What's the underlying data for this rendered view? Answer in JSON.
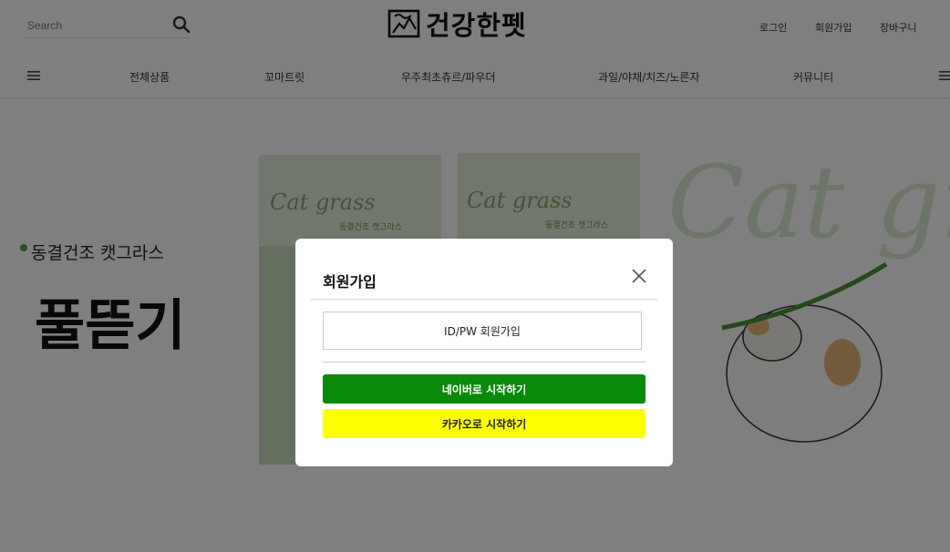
{
  "header": {
    "search_placeholder": "Search",
    "logo_text": "건강한펫",
    "links": [
      "로그인",
      "회원가입",
      "장바구니"
    ]
  },
  "nav": {
    "items": [
      "전체상품",
      "꼬마트릿",
      "우주최초츄르/파우더",
      "과일/야채/치즈/노른자",
      "커뮤니티"
    ]
  },
  "banner": {
    "tagline": "동결건조 캣그라스",
    "headline": "풀뜯기",
    "product_label": "Cat grass",
    "background_script": "Cat grass",
    "package_small_text": "동결건조 캣그라스"
  },
  "modal": {
    "title": "회원가입",
    "idpw_label": "ID/PW 회원가입",
    "naver_label": "네이버로 시작하기",
    "kakao_label": "카카오로 시작하기"
  },
  "colors": {
    "naver": "#0a8a0a",
    "kakao": "#ffff00",
    "overlay": "rgba(0,0,0,0.5)"
  }
}
